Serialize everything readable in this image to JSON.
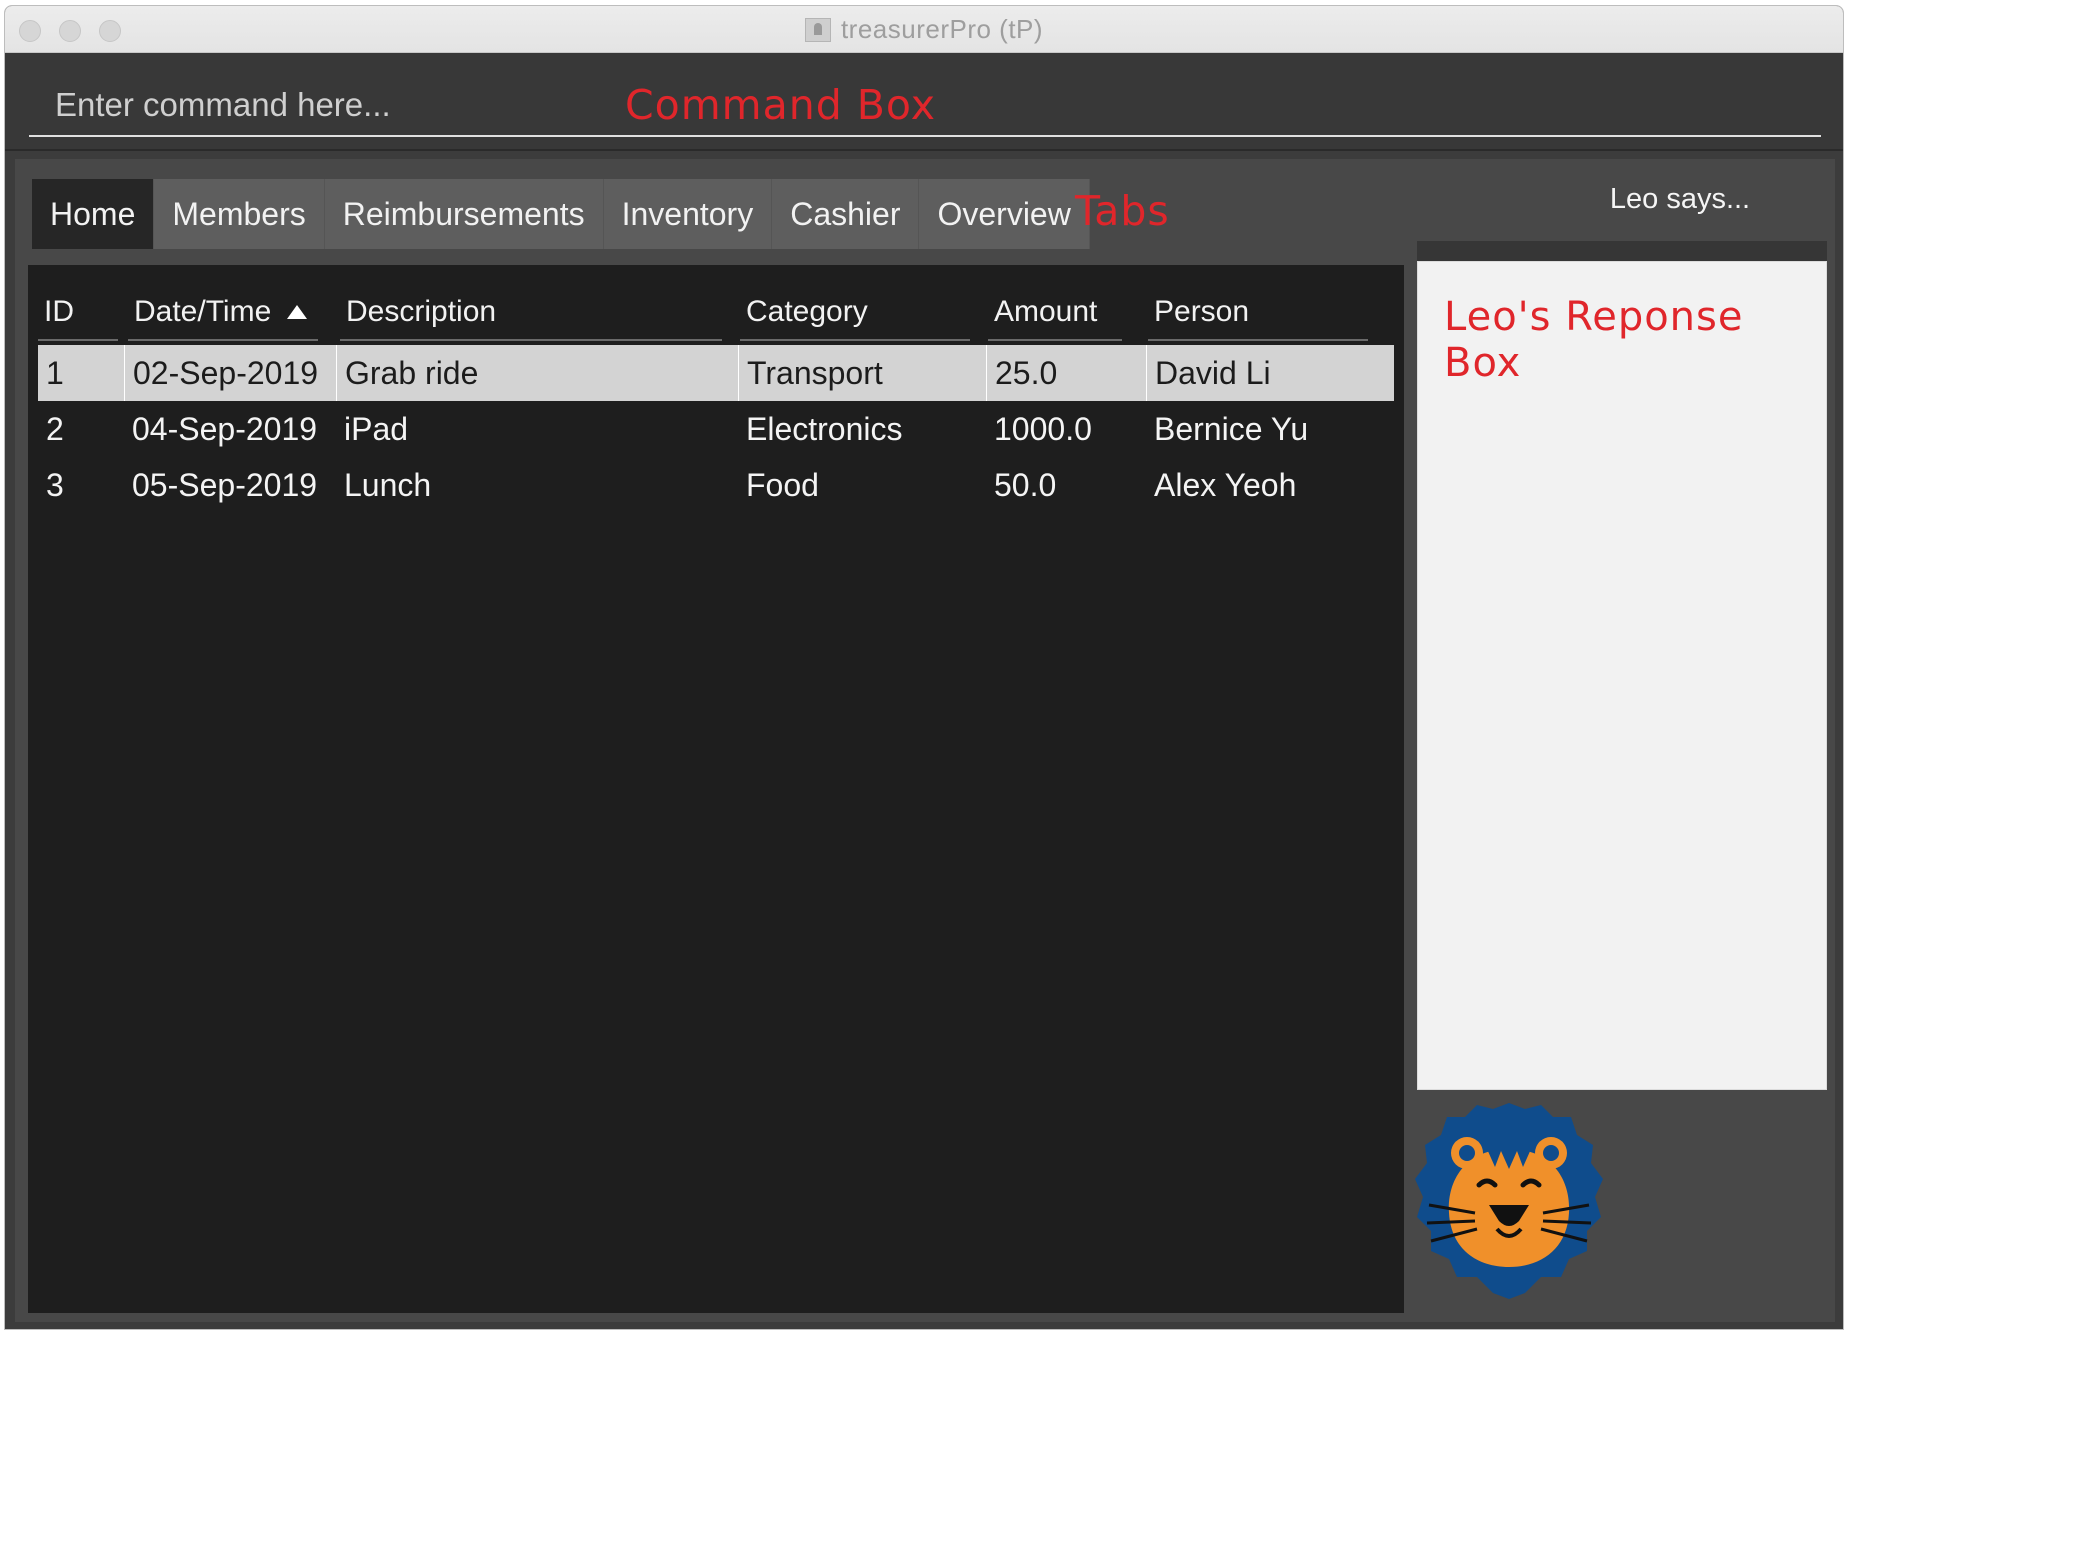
{
  "window": {
    "title": "treasurerPro (tP)"
  },
  "command": {
    "placeholder": "Enter command here...",
    "annotation": "Command Box"
  },
  "tabs": {
    "items": [
      {
        "label": "Home",
        "active": true
      },
      {
        "label": "Members",
        "active": false
      },
      {
        "label": "Reimbursements",
        "active": false
      },
      {
        "label": "Inventory",
        "active": false
      },
      {
        "label": "Cashier",
        "active": false
      },
      {
        "label": "Overview",
        "active": false
      }
    ],
    "annotation": "Tabs"
  },
  "table": {
    "columns": [
      "ID",
      "Date/Time",
      "Description",
      "Category",
      "Amount",
      "Person"
    ],
    "sort_column": "Date/Time",
    "sort_direction": "ascending",
    "rows": [
      {
        "id": "1",
        "datetime": "02-Sep-2019",
        "description": "Grab ride",
        "category": "Transport",
        "amount": "25.0",
        "person": "David Li",
        "selected": true
      },
      {
        "id": "2",
        "datetime": "04-Sep-2019",
        "description": "iPad",
        "category": "Electronics",
        "amount": "1000.0",
        "person": "Bernice Yu",
        "selected": false
      },
      {
        "id": "3",
        "datetime": "05-Sep-2019",
        "description": "Lunch",
        "category": "Food",
        "amount": "50.0",
        "person": "Alex Yeoh",
        "selected": false
      }
    ]
  },
  "leo": {
    "label": "Leo says...",
    "annotation": "Leo's Reponse Box",
    "mascot_icon": "lion-mascot-icon"
  },
  "colors": {
    "annotation_red": "#e0262b",
    "lion_mane": "#0f4c8c",
    "lion_face": "#f0902a"
  }
}
